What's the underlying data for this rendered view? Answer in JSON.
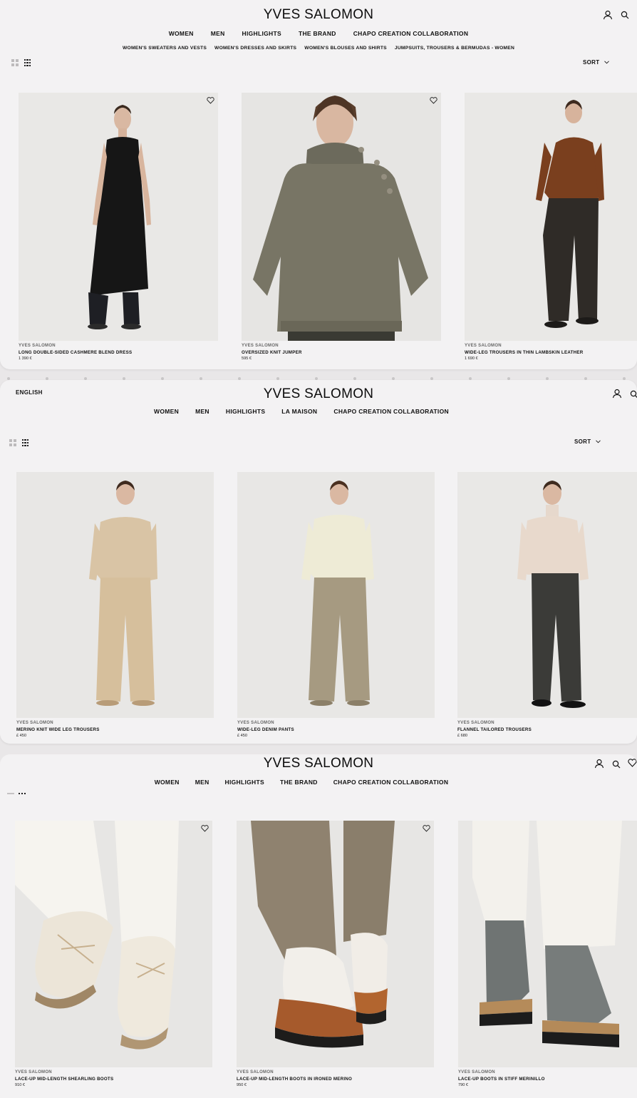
{
  "screens": [
    {
      "logo": "YVES SALOMON",
      "nav": [
        "WOMEN",
        "MEN",
        "HIGHLIGHTS",
        "THE BRAND",
        "CHAPO CREATION COLLABORATION"
      ],
      "subnav": [
        "WOMEN'S SWEATERS AND VESTS",
        "WOMEN'S DRESSES AND SKIRTS",
        "WOMEN'S BLOUSES AND SHIRTS",
        "JUMPSUITS, TROUSERS & BERMUDAS - WOMEN"
      ],
      "sort_label": "SORT",
      "products": [
        {
          "brand": "YVES SALOMON",
          "name": "LONG DOUBLE-SIDED CASHMERE BLEND DRESS",
          "price": "1 390 €"
        },
        {
          "brand": "YVES SALOMON",
          "name": "OVERSIZED KNIT JUMPER",
          "price": "595 €"
        },
        {
          "brand": "YVES SALOMON",
          "name": "WIDE-LEG TROUSERS IN THIN LAMBSKIN LEATHER",
          "price": "1 690 €"
        }
      ]
    },
    {
      "language": "ENGLISH",
      "logo": "YVES SALOMON",
      "nav": [
        "WOMEN",
        "MEN",
        "HIGHLIGHTS",
        "LA MAISON",
        "CHAPO CREATION COLLABORATION"
      ],
      "sort_label": "SORT",
      "products": [
        {
          "brand": "YVES SALOMON",
          "name": "MERINO KNIT WIDE LEG TROUSERS",
          "price": "£ 450"
        },
        {
          "brand": "YVES SALOMON",
          "name": "WIDE-LEG DENIM PANTS",
          "price": "£ 450"
        },
        {
          "brand": "YVES SALOMON",
          "name": "FLANNEL TAILORED TROUSERS",
          "price": "£ 680"
        }
      ]
    },
    {
      "logo": "YVES SALOMON",
      "nav": [
        "WOMEN",
        "MEN",
        "HIGHLIGHTS",
        "THE BRAND",
        "CHAPO CREATION COLLABORATION"
      ],
      "products": [
        {
          "brand": "YVES SALOMON",
          "name": "LACE-UP MID-LENGTH SHEARLING BOOTS",
          "price": "910 €"
        },
        {
          "brand": "YVES SALOMON",
          "name": "LACE-UP MID-LENGTH BOOTS IN IRONED MERINO",
          "price": "950 €"
        },
        {
          "brand": "YVES SALOMON",
          "name": "LACE-UP BOOTS IN STIFF MERINILLO",
          "price": "790 €"
        }
      ]
    }
  ],
  "icons": {
    "account": "user-icon",
    "search": "search-icon",
    "wishlist": "heart-icon",
    "grid_two": "grid-two-columns-icon",
    "grid_three": "grid-three-columns-icon",
    "sort_chevron": "chevron-down-icon"
  }
}
